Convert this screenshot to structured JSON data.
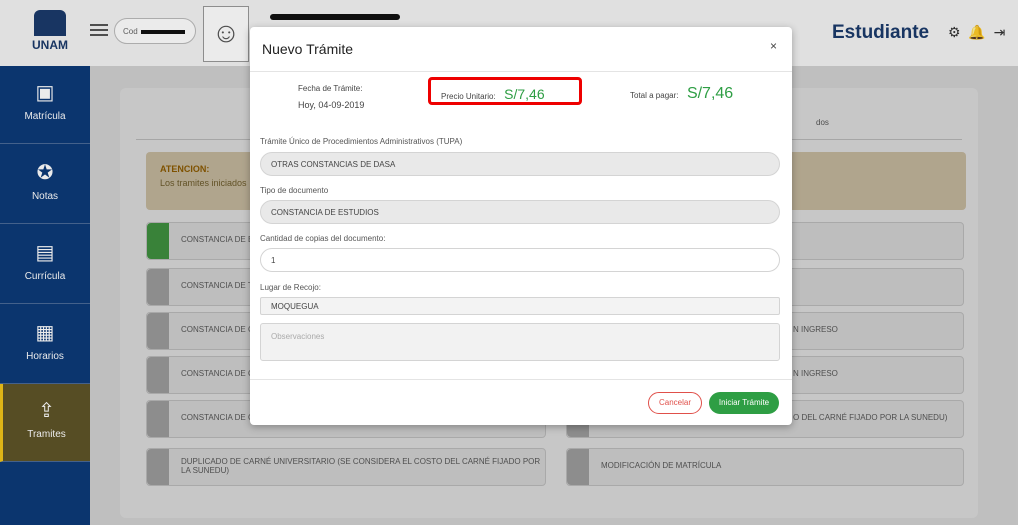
{
  "header": {
    "logo_text": "UNAM",
    "cod_label": "Cod",
    "role": "Estudiante"
  },
  "sidebar": {
    "items": [
      {
        "label": "Matrícula",
        "icon": "monitor-icon"
      },
      {
        "label": "Notas",
        "icon": "award-icon"
      },
      {
        "label": "Currícula",
        "icon": "document-icon"
      },
      {
        "label": "Horarios",
        "icon": "calendar-icon"
      },
      {
        "label": "Tramites",
        "icon": "inbox-upload-icon"
      }
    ]
  },
  "background": {
    "tab_right_fragment": "dos",
    "warning_title": "ATENCION:",
    "warning_text": "Los tramites iniciados",
    "options_left": [
      "CONSTANCIA DE E",
      "CONSTANCIA DE T",
      "CONSTANCIA DE C",
      "CONSTANCIA DE C",
      "CONSTANCIA DE C",
      "DUPLICADO DE CARNÉ UNIVERSITARIO (SE CONSIDERA EL COSTO DEL CARNÉ FIJADO POR LA SUNEDU)"
    ],
    "options_right": [
      "",
      "",
      "N INGRESO",
      "N INGRESO",
      "O DEL CARNÉ FIJADO POR LA SUNEDU)",
      "MODIFICACIÓN DE MATRÍCULA"
    ]
  },
  "modal": {
    "title": "Nuevo Trámite",
    "close": "×",
    "date_label": "Fecha de Trámite:",
    "date_value": "Hoy, 04-09-2019",
    "price_label": "Precio Unitario:",
    "price_value": "S/7,46",
    "total_label": "Total a pagar:",
    "total_value": "S/7,46",
    "tupa_label": "Trámite Único de Procedimientos Administrativos (TUPA)",
    "tupa_value": "OTRAS CONSTANCIAS DE DASA",
    "doc_label": "Tipo de documento",
    "doc_value": "CONSTANCIA DE ESTUDIOS",
    "copies_label": "Cantidad de copias del documento:",
    "copies_value": "1",
    "pickup_label": "Lugar de Recojo:",
    "pickup_value": "MOQUEGUA",
    "obs_placeholder": "Observaciones",
    "cancel_label": "Cancelar",
    "start_label": "Iniciar Trámite"
  },
  "colors": {
    "brand": "#0d3a78",
    "accent": "#2e9e44",
    "highlight": "#ee0000"
  }
}
